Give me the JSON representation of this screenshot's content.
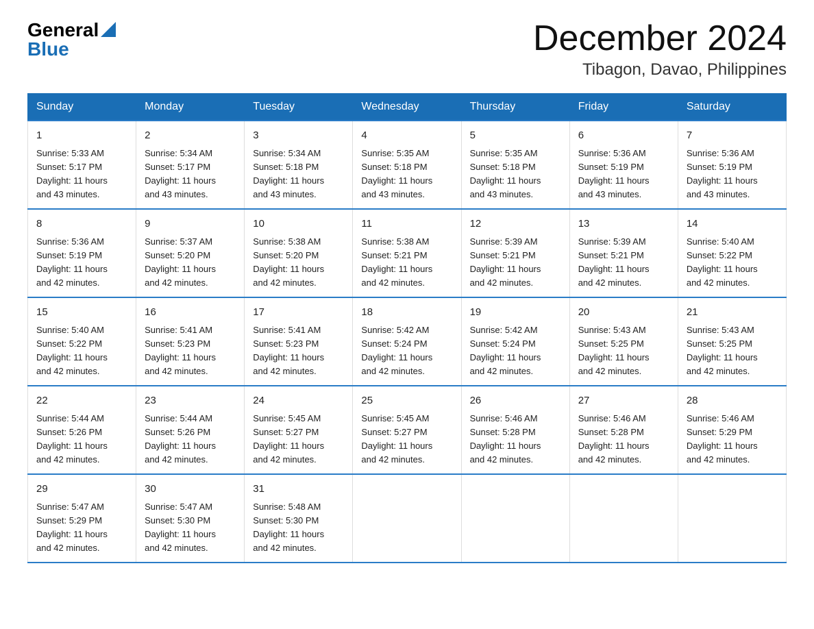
{
  "header": {
    "title": "December 2024",
    "subtitle": "Tibagon, Davao, Philippines",
    "logo_line1": "General",
    "logo_line2": "Blue"
  },
  "weekdays": [
    "Sunday",
    "Monday",
    "Tuesday",
    "Wednesday",
    "Thursday",
    "Friday",
    "Saturday"
  ],
  "weeks": [
    [
      {
        "day": "1",
        "sunrise": "5:33 AM",
        "sunset": "5:17 PM",
        "daylight": "11 hours and 43 minutes."
      },
      {
        "day": "2",
        "sunrise": "5:34 AM",
        "sunset": "5:17 PM",
        "daylight": "11 hours and 43 minutes."
      },
      {
        "day": "3",
        "sunrise": "5:34 AM",
        "sunset": "5:18 PM",
        "daylight": "11 hours and 43 minutes."
      },
      {
        "day": "4",
        "sunrise": "5:35 AM",
        "sunset": "5:18 PM",
        "daylight": "11 hours and 43 minutes."
      },
      {
        "day": "5",
        "sunrise": "5:35 AM",
        "sunset": "5:18 PM",
        "daylight": "11 hours and 43 minutes."
      },
      {
        "day": "6",
        "sunrise": "5:36 AM",
        "sunset": "5:19 PM",
        "daylight": "11 hours and 43 minutes."
      },
      {
        "day": "7",
        "sunrise": "5:36 AM",
        "sunset": "5:19 PM",
        "daylight": "11 hours and 43 minutes."
      }
    ],
    [
      {
        "day": "8",
        "sunrise": "5:36 AM",
        "sunset": "5:19 PM",
        "daylight": "11 hours and 42 minutes."
      },
      {
        "day": "9",
        "sunrise": "5:37 AM",
        "sunset": "5:20 PM",
        "daylight": "11 hours and 42 minutes."
      },
      {
        "day": "10",
        "sunrise": "5:38 AM",
        "sunset": "5:20 PM",
        "daylight": "11 hours and 42 minutes."
      },
      {
        "day": "11",
        "sunrise": "5:38 AM",
        "sunset": "5:21 PM",
        "daylight": "11 hours and 42 minutes."
      },
      {
        "day": "12",
        "sunrise": "5:39 AM",
        "sunset": "5:21 PM",
        "daylight": "11 hours and 42 minutes."
      },
      {
        "day": "13",
        "sunrise": "5:39 AM",
        "sunset": "5:21 PM",
        "daylight": "11 hours and 42 minutes."
      },
      {
        "day": "14",
        "sunrise": "5:40 AM",
        "sunset": "5:22 PM",
        "daylight": "11 hours and 42 minutes."
      }
    ],
    [
      {
        "day": "15",
        "sunrise": "5:40 AM",
        "sunset": "5:22 PM",
        "daylight": "11 hours and 42 minutes."
      },
      {
        "day": "16",
        "sunrise": "5:41 AM",
        "sunset": "5:23 PM",
        "daylight": "11 hours and 42 minutes."
      },
      {
        "day": "17",
        "sunrise": "5:41 AM",
        "sunset": "5:23 PM",
        "daylight": "11 hours and 42 minutes."
      },
      {
        "day": "18",
        "sunrise": "5:42 AM",
        "sunset": "5:24 PM",
        "daylight": "11 hours and 42 minutes."
      },
      {
        "day": "19",
        "sunrise": "5:42 AM",
        "sunset": "5:24 PM",
        "daylight": "11 hours and 42 minutes."
      },
      {
        "day": "20",
        "sunrise": "5:43 AM",
        "sunset": "5:25 PM",
        "daylight": "11 hours and 42 minutes."
      },
      {
        "day": "21",
        "sunrise": "5:43 AM",
        "sunset": "5:25 PM",
        "daylight": "11 hours and 42 minutes."
      }
    ],
    [
      {
        "day": "22",
        "sunrise": "5:44 AM",
        "sunset": "5:26 PM",
        "daylight": "11 hours and 42 minutes."
      },
      {
        "day": "23",
        "sunrise": "5:44 AM",
        "sunset": "5:26 PM",
        "daylight": "11 hours and 42 minutes."
      },
      {
        "day": "24",
        "sunrise": "5:45 AM",
        "sunset": "5:27 PM",
        "daylight": "11 hours and 42 minutes."
      },
      {
        "day": "25",
        "sunrise": "5:45 AM",
        "sunset": "5:27 PM",
        "daylight": "11 hours and 42 minutes."
      },
      {
        "day": "26",
        "sunrise": "5:46 AM",
        "sunset": "5:28 PM",
        "daylight": "11 hours and 42 minutes."
      },
      {
        "day": "27",
        "sunrise": "5:46 AM",
        "sunset": "5:28 PM",
        "daylight": "11 hours and 42 minutes."
      },
      {
        "day": "28",
        "sunrise": "5:46 AM",
        "sunset": "5:29 PM",
        "daylight": "11 hours and 42 minutes."
      }
    ],
    [
      {
        "day": "29",
        "sunrise": "5:47 AM",
        "sunset": "5:29 PM",
        "daylight": "11 hours and 42 minutes."
      },
      {
        "day": "30",
        "sunrise": "5:47 AM",
        "sunset": "5:30 PM",
        "daylight": "11 hours and 42 minutes."
      },
      {
        "day": "31",
        "sunrise": "5:48 AM",
        "sunset": "5:30 PM",
        "daylight": "11 hours and 42 minutes."
      },
      null,
      null,
      null,
      null
    ]
  ],
  "labels": {
    "sunrise": "Sunrise:",
    "sunset": "Sunset:",
    "daylight": "Daylight:"
  }
}
